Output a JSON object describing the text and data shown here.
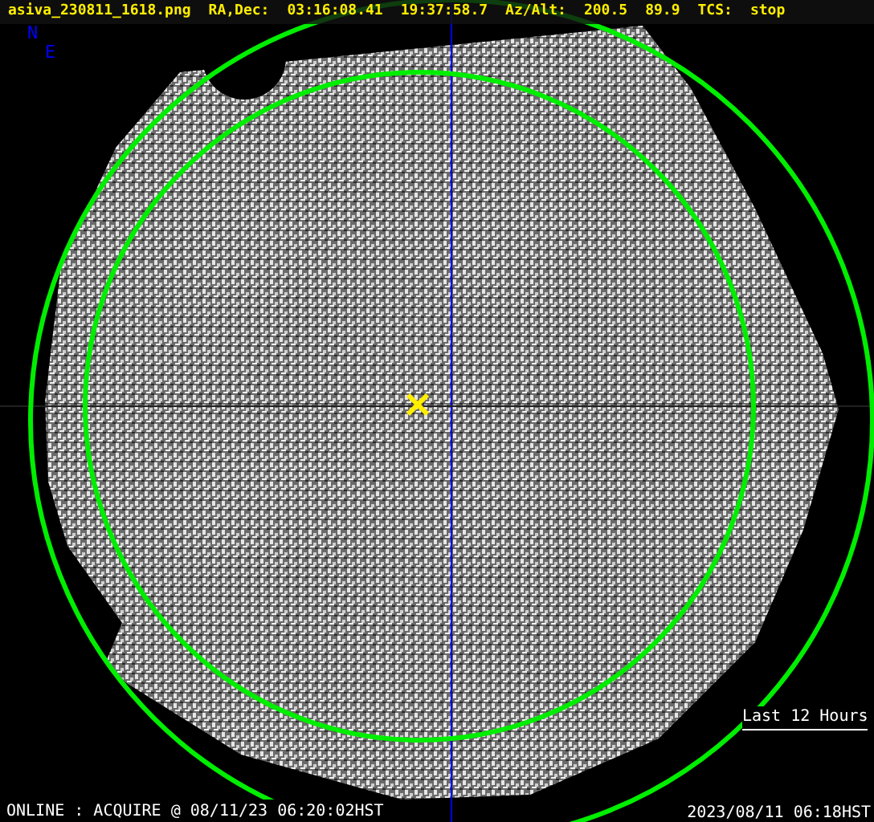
{
  "header": {
    "filename": "asiva_230811_1618.png",
    "fields": [
      {
        "label": "RA,Dec:",
        "values": [
          "03:16:08.41",
          "19:37:58.7"
        ]
      },
      {
        "label": "Az/Alt:",
        "values": [
          "200.5",
          "89.9"
        ]
      },
      {
        "label": "TCS:",
        "values": [
          "stop"
        ]
      }
    ]
  },
  "compass": {
    "north": "N",
    "east": "E"
  },
  "range_link": "Last 12 Hours",
  "status": "ONLINE : ACQUIRE @ 08/11/23 06:20:02HST",
  "timestamp": "2023/08/11 06:18HST"
}
